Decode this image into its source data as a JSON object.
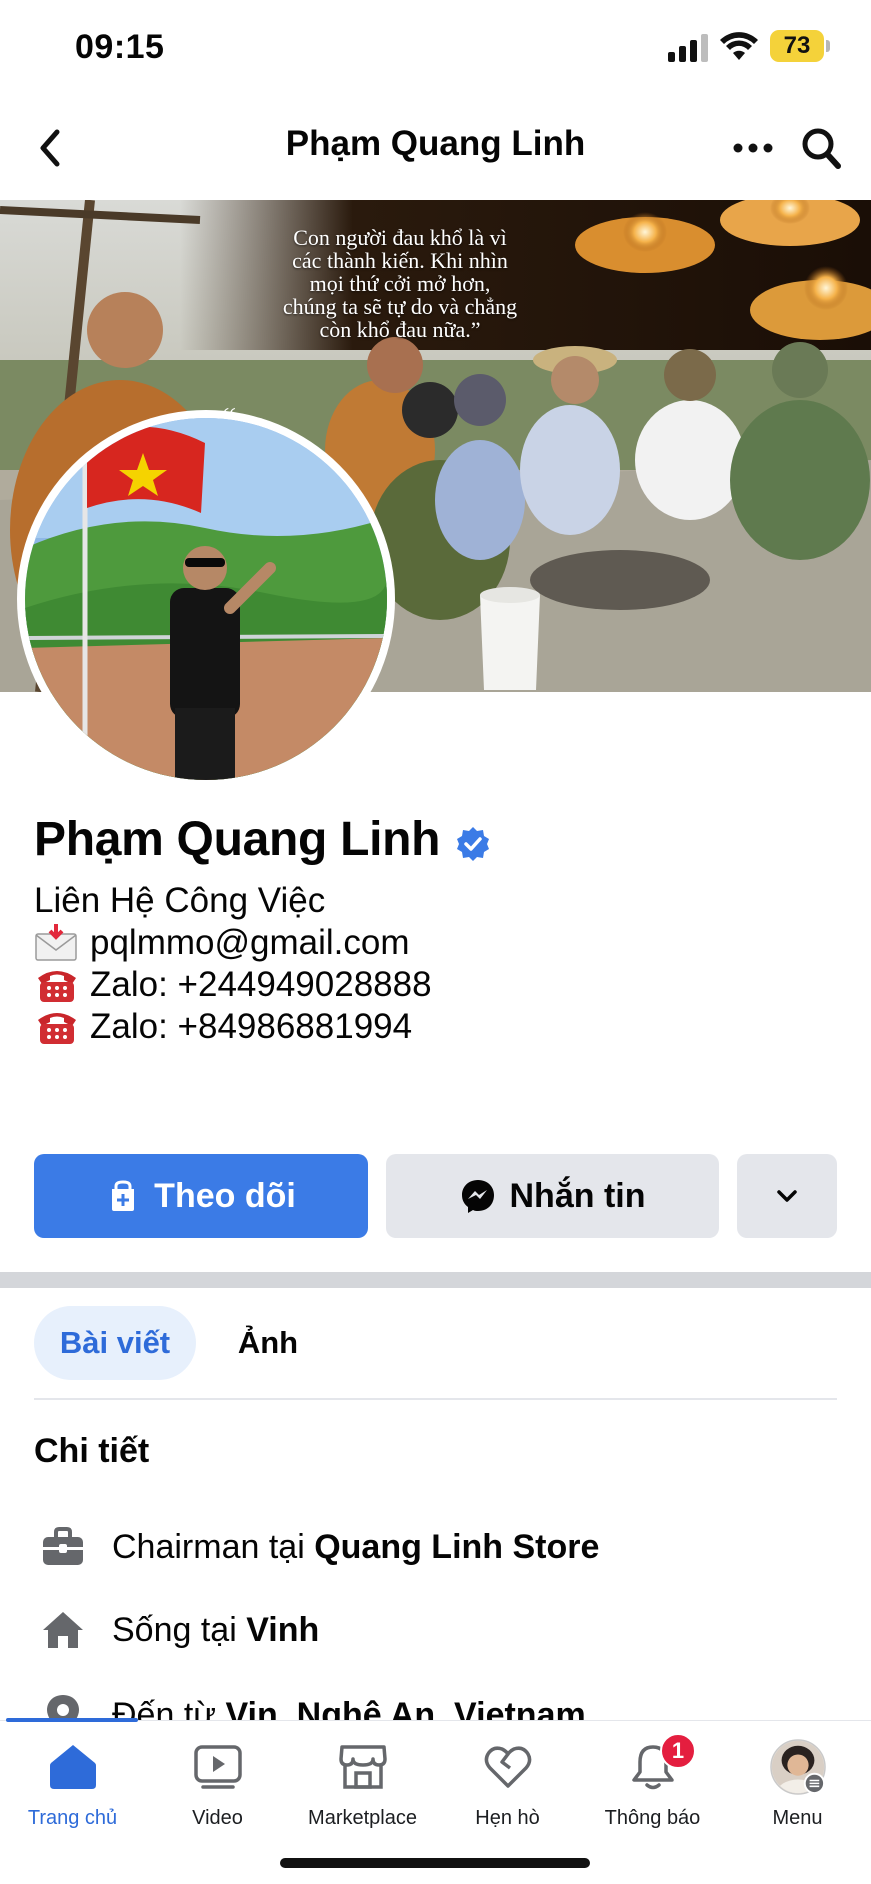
{
  "status_bar": {
    "time": "09:15",
    "battery": "73"
  },
  "header": {
    "title": "Phạm Quang Linh"
  },
  "cover": {
    "quote_mark": "“",
    "quote_lines": [
      "Con người đau khổ là vì",
      "các thành kiến. Khi nhìn",
      "mọi thứ cởi mở hơn,",
      "chúng ta sẽ tự do và chẳng",
      "còn khổ đau nữa.”"
    ]
  },
  "profile": {
    "name": "Phạm Quang Linh",
    "verified": true,
    "bio": [
      {
        "icon": "envelope-icon",
        "text": "Liên Hệ Công Việc"
      },
      {
        "icon": "envelope-icon",
        "text": "pqlmmo@gmail.com"
      },
      {
        "icon": "telephone-icon",
        "text": "Zalo: +244949028888"
      },
      {
        "icon": "telephone-icon",
        "text": "Zalo: +84986881994"
      }
    ]
  },
  "actions": {
    "follow_label": "Theo dõi",
    "message_label": "Nhắn tin"
  },
  "tabs": [
    {
      "label": "Bài viết",
      "active": true
    },
    {
      "label": "Ảnh",
      "active": false
    }
  ],
  "details": {
    "title": "Chi tiết",
    "items": [
      {
        "icon": "briefcase-icon",
        "prefix": "Chairman tại ",
        "bold": "Quang Linh Store"
      },
      {
        "icon": "house-icon",
        "prefix": "Sống tại ",
        "bold": "Vinh"
      },
      {
        "icon": "location-pin-icon",
        "prefix": "Đến từ ",
        "bold": "Vin, Nghệ An, Vietnam"
      }
    ]
  },
  "bottom_nav": {
    "items": [
      {
        "label": "Trang chủ",
        "icon": "home-icon",
        "active": true
      },
      {
        "label": "Video",
        "icon": "video-icon",
        "active": false
      },
      {
        "label": "Marketplace",
        "icon": "marketplace-icon",
        "active": false
      },
      {
        "label": "Hẹn hò",
        "icon": "heart-icon",
        "active": false
      },
      {
        "label": "Thông báo",
        "icon": "bell-icon",
        "active": false,
        "badge": "1"
      },
      {
        "label": "Menu",
        "icon": "avatar-menu-icon",
        "active": false
      }
    ]
  },
  "colors": {
    "accent": "#3b7be6",
    "active_tab": "#2e6bd9",
    "badge": "#e41e3f",
    "battery": "#f4d23a"
  }
}
